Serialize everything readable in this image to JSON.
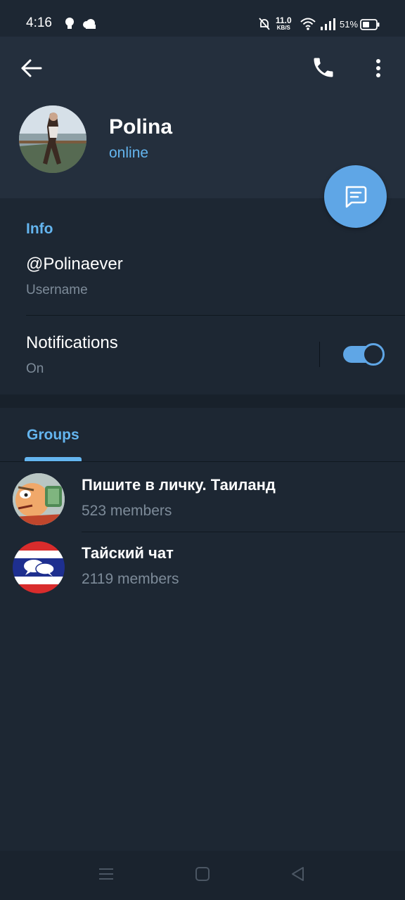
{
  "status_bar": {
    "time": "4:16",
    "speed": "11.0",
    "speed_unit": "KB/S",
    "battery": "51%",
    "icons": [
      "bulb-icon",
      "cloud-icon",
      "bell-off-icon",
      "wifi-icon",
      "signal-icon",
      "battery-icon"
    ]
  },
  "header": {
    "name": "Polina",
    "status": "online",
    "icons": [
      "back-arrow-icon",
      "phone-icon",
      "more-vertical-icon",
      "message-icon"
    ]
  },
  "info": {
    "title": "Info",
    "username": "@Polinaever",
    "username_label": "Username",
    "notifications_title": "Notifications",
    "notifications_value": "On",
    "notifications_enabled": true
  },
  "groups": {
    "tab_label": "Groups",
    "items": [
      {
        "name": "Пишите в личку. Таиланд",
        "members": "523 members"
      },
      {
        "name": "Тайский чат",
        "members": "2119 members"
      }
    ]
  },
  "colors": {
    "accent": "#64b5ef",
    "fab": "#5fa6e6",
    "background": "#1d2733",
    "header": "#242f3d"
  }
}
